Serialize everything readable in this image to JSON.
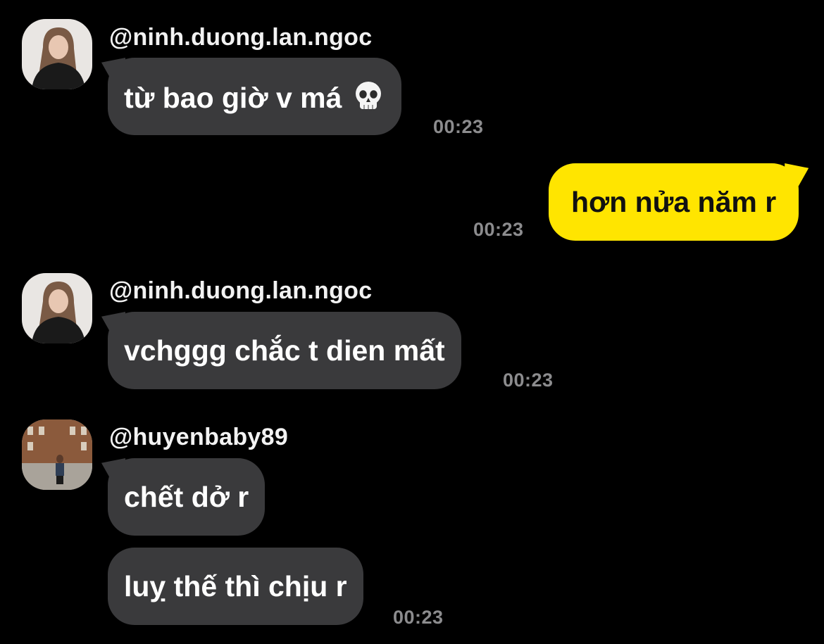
{
  "messages": [
    {
      "username": "@ninh.duong.lan.ngoc",
      "text": "từ bao giờ v má",
      "emoji": "skull-emoji",
      "time": "00:23"
    },
    {
      "text": "hơn nửa năm r",
      "time": "00:23",
      "outgoing": true
    },
    {
      "username": "@ninh.duong.lan.ngoc",
      "text": "vchggg chắc t dien mất",
      "time": "00:23"
    },
    {
      "username": "@huyenbaby89",
      "text": "chết dở r"
    },
    {
      "text": "luỵ thế thì chịu r",
      "time": "00:23"
    }
  ],
  "colors": {
    "background": "#000000",
    "incoming_bubble": "#3a3a3c",
    "outgoing_bubble": "#ffe500",
    "timestamp": "#8c8c8e"
  }
}
